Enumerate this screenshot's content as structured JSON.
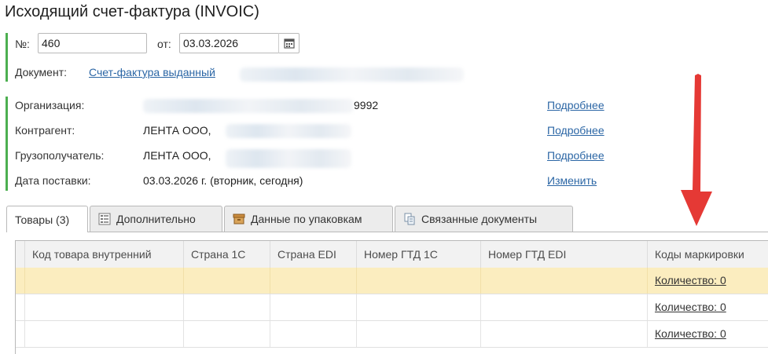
{
  "title": "Исходящий счет-фактура (INVOIC)",
  "header": {
    "number_label": "№:",
    "number_value": "460",
    "date_label": "от:",
    "date_value": "03.03.2026",
    "document_label": "Документ:",
    "document_link": "Счет-фактура выданный"
  },
  "info": {
    "organization_label": "Организация:",
    "organization_value_tail": "9992",
    "counterparty_label": "Контрагент:",
    "counterparty_value": "ЛЕНТА ООО,",
    "consignee_label": "Грузополучатель:",
    "consignee_value": "ЛЕНТА ООО,",
    "delivery_label": "Дата поставки:",
    "delivery_value": "03.03.2026 г. (вторник, сегодня)",
    "more_link_1": "Подробнее",
    "more_link_2": "Подробнее",
    "more_link_3": "Подробнее",
    "change_link": "Изменить"
  },
  "tabs": [
    {
      "label": "Товары (3)",
      "icon": "none",
      "active": true
    },
    {
      "label": "Дополнительно",
      "icon": "list-icon"
    },
    {
      "label": "Данные по упаковкам",
      "icon": "package-icon"
    },
    {
      "label": "Связанные документы",
      "icon": "linked-docs-icon"
    }
  ],
  "table": {
    "columns": [
      "Код товара внутренний",
      "Страна 1С",
      "Страна EDI",
      "Номер ГТД 1С",
      "Номер ГТД EDI",
      "Коды маркировки"
    ],
    "rows": [
      {
        "marking_codes": "Количество: 0"
      },
      {
        "marking_codes": "Количество: 0"
      },
      {
        "marking_codes": "Количество: 0"
      }
    ]
  },
  "colors": {
    "accent_green": "#4caf50",
    "link_blue": "#2b66a5",
    "selected_row": "#fbedbf",
    "arrow_red": "#e53935"
  }
}
